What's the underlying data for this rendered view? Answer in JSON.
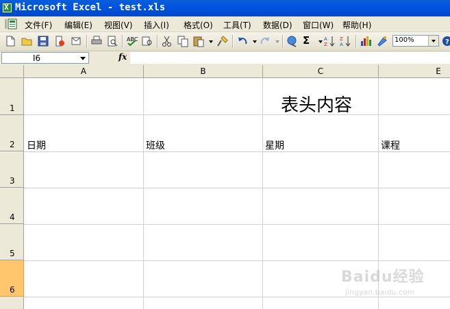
{
  "window": {
    "title": "Microsoft Excel - test.xls",
    "app_icon_letter": "X"
  },
  "menu": {
    "items": [
      "文件(F)",
      "编辑(E)",
      "视图(V)",
      "插入(I)",
      "格式(O)",
      "工具(T)",
      "数据(D)",
      "窗口(W)",
      "帮助(H)"
    ]
  },
  "toolbar": {
    "zoom": "100%",
    "sum_symbol": "Σ"
  },
  "formula_bar": {
    "name_box": "I6",
    "fx": "fx",
    "value": ""
  },
  "grid": {
    "columns": [
      "A",
      "B",
      "C",
      "E"
    ],
    "rows": [
      "1",
      "2",
      "3",
      "4",
      "5",
      "6"
    ],
    "selected_row": "6",
    "header_title": "表头内容",
    "row2_cells": [
      "日期",
      "班级",
      "星期",
      "课程"
    ]
  },
  "watermark": {
    "main": "Baidu经验",
    "sub": "jingyan.baidu.com"
  }
}
